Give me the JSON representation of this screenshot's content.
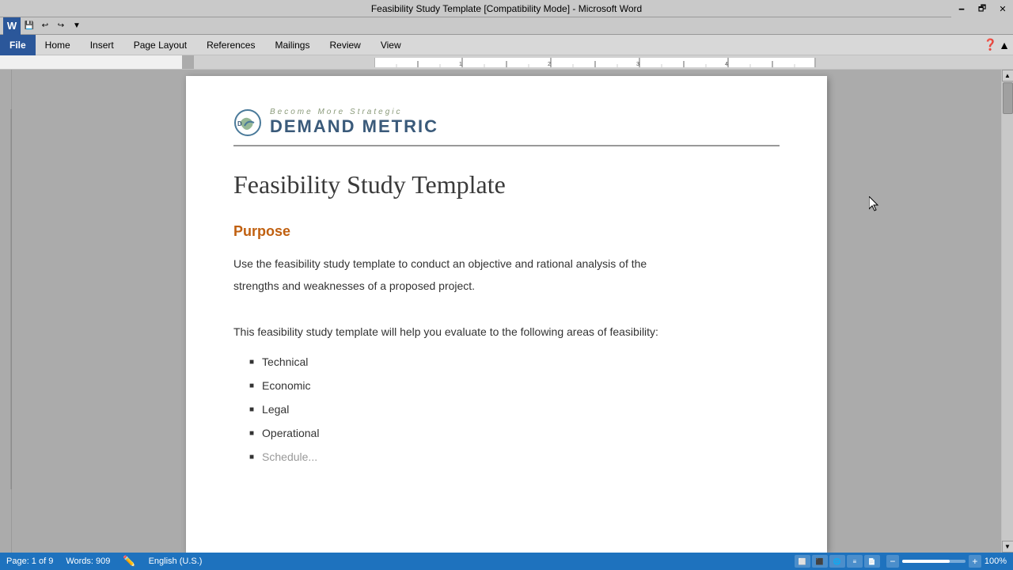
{
  "titleBar": {
    "title": "Feasibility Study Template [Compatibility Mode] - Microsoft Word",
    "minimize": "🗕",
    "maximize": "🗗",
    "close": "✕"
  },
  "quickAccess": {
    "save": "💾",
    "undo": "↩",
    "redo": "↪",
    "more": "▼"
  },
  "ribbon": {
    "tabs": [
      "File",
      "Home",
      "Insert",
      "Page Layout",
      "References",
      "Mailings",
      "Review",
      "View"
    ],
    "activeTab": "File"
  },
  "document": {
    "logoTagline": "Become More Strategic",
    "logoName": "Demand Metric",
    "title": "Feasibility Study Template",
    "sections": [
      {
        "heading": "Purpose",
        "paragraphs": [
          "Use the feasibility study template to conduct an objective and rational analysis of the",
          "strengths and weaknesses of a proposed project."
        ]
      }
    ],
    "introText": "This feasibility study template will help you evaluate to the following areas of feasibility:",
    "bulletItems": [
      "Technical",
      "Economic",
      "Legal",
      "Operational"
    ]
  },
  "statusBar": {
    "pageInfo": "Page: 1 of 9",
    "wordCount": "Words: 909",
    "language": "English (U.S.)",
    "zoom": "100%"
  },
  "colors": {
    "accent": "#c06010",
    "logoBlue": "#3a5a7a",
    "fileTab": "#2b579a"
  }
}
